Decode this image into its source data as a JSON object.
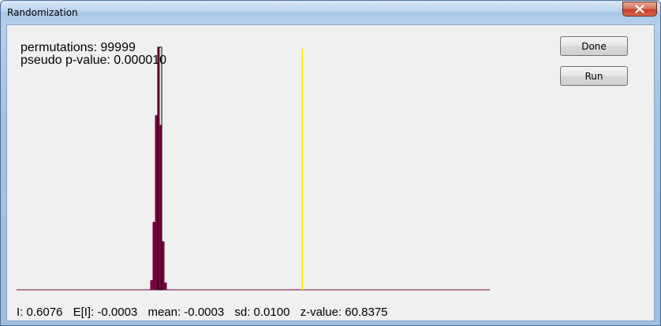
{
  "window": {
    "title": "Randomization"
  },
  "info": {
    "permutations_text": "permutations: 99999",
    "pvalue_text": "pseudo p-value: 0.000010"
  },
  "buttons": {
    "done_label": "Done",
    "run_label": "Run"
  },
  "stats": {
    "i_text": "I: 0.6076",
    "ei_text": "E[I]: -0.0003",
    "mean_text": "mean: -0.0003",
    "sd_text": "sd: 0.0100",
    "z_text": "z-value: 60.8375"
  },
  "colors": {
    "histogram_fill": "#7a003d",
    "observed_line": "#ffee00",
    "baseline": "#7a003d"
  },
  "chart_data": {
    "type": "bar",
    "description_free": true,
    "bins": [
      {
        "x": -0.03,
        "count": 0.04
      },
      {
        "x": -0.02,
        "count": 0.28
      },
      {
        "x": -0.01,
        "count": 0.72
      },
      {
        "x": 0.0,
        "count": 1.0
      },
      {
        "x": 0.01,
        "count": 0.68
      },
      {
        "x": 0.02,
        "count": 0.2
      },
      {
        "x": 0.03,
        "count": 0.03
      }
    ],
    "observed_value": 0.6076,
    "xlim": [
      -0.6,
      1.4
    ]
  }
}
